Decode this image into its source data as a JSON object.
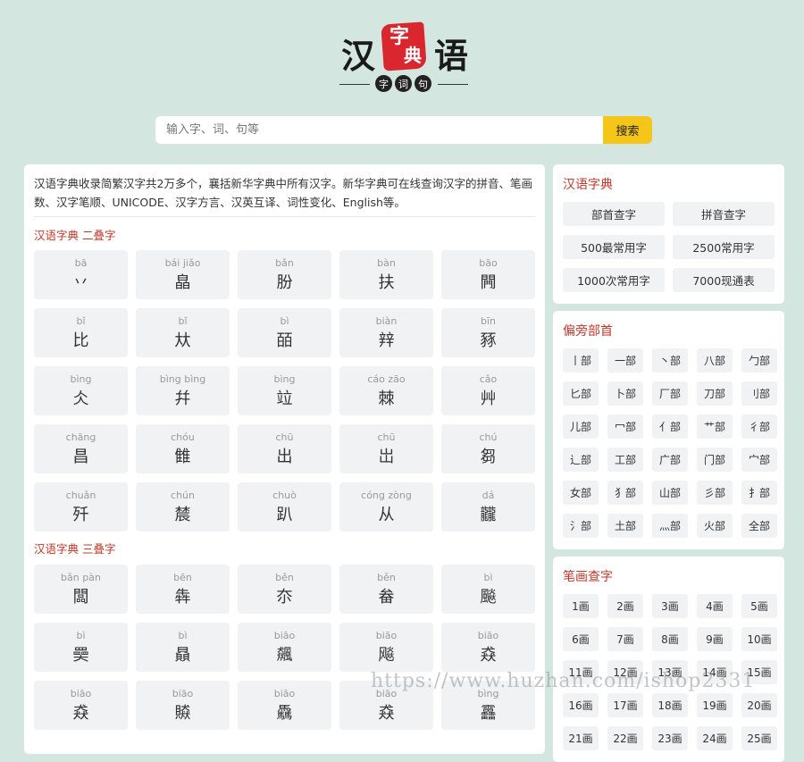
{
  "logo": {
    "chars": [
      "汉",
      "语"
    ],
    "seal": [
      "字",
      "典"
    ],
    "dots": [
      "字",
      "词",
      "句"
    ]
  },
  "search": {
    "placeholder": "输入字、词、句等",
    "button": "搜索"
  },
  "intro": "汉语字典收录简繁汉字共2万多个，襄括新华字典中所有汉字。新华字典可在线查询汉字的拼音、笔画数、汉字笔顺、UNICODE、汉字方言、汉英互译、词性变化、English等。",
  "section1": {
    "title": "汉语字典 二叠字",
    "items": [
      {
        "py": "bā",
        "hz": "丷"
      },
      {
        "py": "bái jiǎo",
        "hz": "皛"
      },
      {
        "py": "bǎn",
        "hz": "朌"
      },
      {
        "py": "bàn",
        "hz": "扶"
      },
      {
        "py": "bāo",
        "hz": "闁"
      },
      {
        "py": "bǐ",
        "hz": "比"
      },
      {
        "py": "bǐ",
        "hz": "夶"
      },
      {
        "py": "bì",
        "hz": "皕"
      },
      {
        "py": "biàn",
        "hz": "辡"
      },
      {
        "py": "bīn",
        "hz": "豩"
      },
      {
        "py": "bìng",
        "hz": "仌"
      },
      {
        "py": "bìng bìng",
        "hz": "幷"
      },
      {
        "py": "bìng",
        "hz": "竝"
      },
      {
        "py": "cáo zāo",
        "hz": "棘"
      },
      {
        "py": "cǎo",
        "hz": "艸"
      },
      {
        "py": "chāng",
        "hz": "昌"
      },
      {
        "py": "chóu",
        "hz": "雔"
      },
      {
        "py": "chū",
        "hz": "出"
      },
      {
        "py": "chū",
        "hz": "岀"
      },
      {
        "py": "chú",
        "hz": "芻"
      },
      {
        "py": "chuǎn",
        "hz": "歼"
      },
      {
        "py": "chún",
        "hz": "辳"
      },
      {
        "py": "chuò",
        "hz": "趴"
      },
      {
        "py": "cóng zòng",
        "hz": "从"
      },
      {
        "py": "dá",
        "hz": "龖"
      }
    ]
  },
  "section2": {
    "title": "汉语字典 三叠字",
    "items": [
      {
        "py": "bǎn pàn",
        "hz": "闆"
      },
      {
        "py": "bēn",
        "hz": "犇"
      },
      {
        "py": "běn",
        "hz": "夵"
      },
      {
        "py": "běn",
        "hz": "畚"
      },
      {
        "py": "bì",
        "hz": "飈"
      },
      {
        "py": "bì",
        "hz": "奰"
      },
      {
        "py": "bì",
        "hz": "贔"
      },
      {
        "py": "biāo",
        "hz": "飆"
      },
      {
        "py": "biāo",
        "hz": "飚"
      },
      {
        "py": "biāo",
        "hz": "猋"
      },
      {
        "py": "biāo",
        "hz": "猋"
      },
      {
        "py": "biāo",
        "hz": "贆"
      },
      {
        "py": "biāo",
        "hz": "驫"
      },
      {
        "py": "biāo",
        "hz": "猋"
      },
      {
        "py": "bìng",
        "hz": "靐"
      }
    ]
  },
  "card_dict": {
    "title": "汉语字典",
    "buttons": [
      "部首查字",
      "拼音查字",
      "500最常用字",
      "2500常用字",
      "1000次常用字",
      "7000现通表"
    ]
  },
  "card_radicals": {
    "title": "偏旁部首",
    "buttons": [
      "丨部",
      "一部",
      "丶部",
      "八部",
      "勹部",
      "匕部",
      "卜部",
      "厂部",
      "刀部",
      "刂部",
      "儿部",
      "冖部",
      "亻部",
      "艹部",
      "彳部",
      "辶部",
      "工部",
      "广部",
      "门部",
      "宀部",
      "女部",
      "犭部",
      "山部",
      "彡部",
      "扌部",
      "氵部",
      "土部",
      "灬部",
      "火部",
      "全部"
    ]
  },
  "card_strokes": {
    "title": "笔画查字",
    "buttons": [
      "1画",
      "2画",
      "3画",
      "4画",
      "5画",
      "6画",
      "7画",
      "8画",
      "9画",
      "10画",
      "11画",
      "12画",
      "13画",
      "14画",
      "15画",
      "16画",
      "17画",
      "18画",
      "19画",
      "20画",
      "21画",
      "22画",
      "23画",
      "24画",
      "25画"
    ]
  },
  "watermark": "https://www.huzhan.com/ishop2331"
}
